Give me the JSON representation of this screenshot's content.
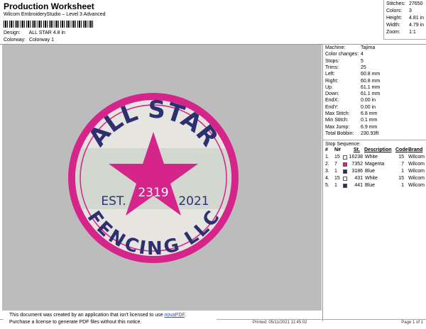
{
  "header": {
    "title": "Production Worksheet",
    "subtitle": "Wilcom EmbroideryStudio – Level 3 Advanced",
    "design_label": "Design:",
    "design_value": "ALL STAR 4.8 in",
    "colorway_label": "Colorway:",
    "colorway_value": "Colorway 1"
  },
  "top_stats": [
    {
      "k": "Stitches:",
      "v": "27650"
    },
    {
      "k": "Colors:",
      "v": "3"
    },
    {
      "k": "Height:",
      "v": "4.81 in"
    },
    {
      "k": "Width:",
      "v": "4.79 in"
    },
    {
      "k": "Zoom:",
      "v": "1:1"
    }
  ],
  "machine_info": [
    {
      "k": "Machine:",
      "v": "Tajima"
    },
    {
      "k": "Color changes:",
      "v": "4"
    },
    {
      "k": "Stops:",
      "v": "5"
    },
    {
      "k": "Trims:",
      "v": "25"
    },
    {
      "k": "Left:",
      "v": "60.8 mm"
    },
    {
      "k": "Right:",
      "v": "60.8 mm"
    },
    {
      "k": "Up:",
      "v": "61.1 mm"
    },
    {
      "k": "Down:",
      "v": "61.1 mm"
    },
    {
      "k": "EndX:",
      "v": "0.00 in"
    },
    {
      "k": "EndY:",
      "v": "0.00 in"
    },
    {
      "k": "Max Stitch:",
      "v": "6.8 mm"
    },
    {
      "k": "Min Stitch:",
      "v": "0.1 mm"
    },
    {
      "k": "Max Jump:",
      "v": "6.9 mm"
    },
    {
      "k": "Total Bobbin:",
      "v": "230.93ft"
    }
  ],
  "stop_sequence": {
    "title": "Stop Sequence:",
    "headers": [
      "#",
      "N#",
      "St.",
      "Description",
      "Code",
      "Brand"
    ],
    "rows": [
      {
        "n": "1.",
        "needle": "15",
        "color": "#ffffff",
        "st": "16238",
        "desc": "White",
        "code": "15",
        "brand": "Wilcom"
      },
      {
        "n": "2.",
        "needle": "7",
        "color": "#d6258a",
        "st": "7352",
        "desc": "Magenta",
        "code": "7",
        "brand": "Wilcom"
      },
      {
        "n": "3.",
        "needle": "1",
        "color": "#2a2a6e",
        "st": "3186",
        "desc": "Blue",
        "code": "1",
        "brand": "Wilcom"
      },
      {
        "n": "4.",
        "needle": "15",
        "color": "#ffffff",
        "st": "431",
        "desc": "White",
        "code": "15",
        "brand": "Wilcom"
      },
      {
        "n": "5.",
        "needle": "1",
        "color": "#2a2a6e",
        "st": "441",
        "desc": "Blue",
        "code": "1",
        "brand": "Wilcom"
      }
    ]
  },
  "design": {
    "top_text": "ALL STAR",
    "bottom_text": "FENCING LLC",
    "left_text": "EST.",
    "right_text": "2021",
    "center_text": "2319",
    "colors": {
      "ring": "#d6258a",
      "star": "#d6258a",
      "text": "#2d3070",
      "fill": "#e7e5df",
      "band": "#d2d8cf"
    }
  },
  "notice": {
    "line1_pre": "This document was created by an application that isn't licensed to use ",
    "line1_link": "novaPDF",
    "line1_post": ".",
    "line2": "Purchase a license to generate PDF files without this notice."
  },
  "footer": {
    "left": "Cr",
    "printed": "Printed: 05/11/2021 11:45:02",
    "page": "Page 1 of 1"
  }
}
